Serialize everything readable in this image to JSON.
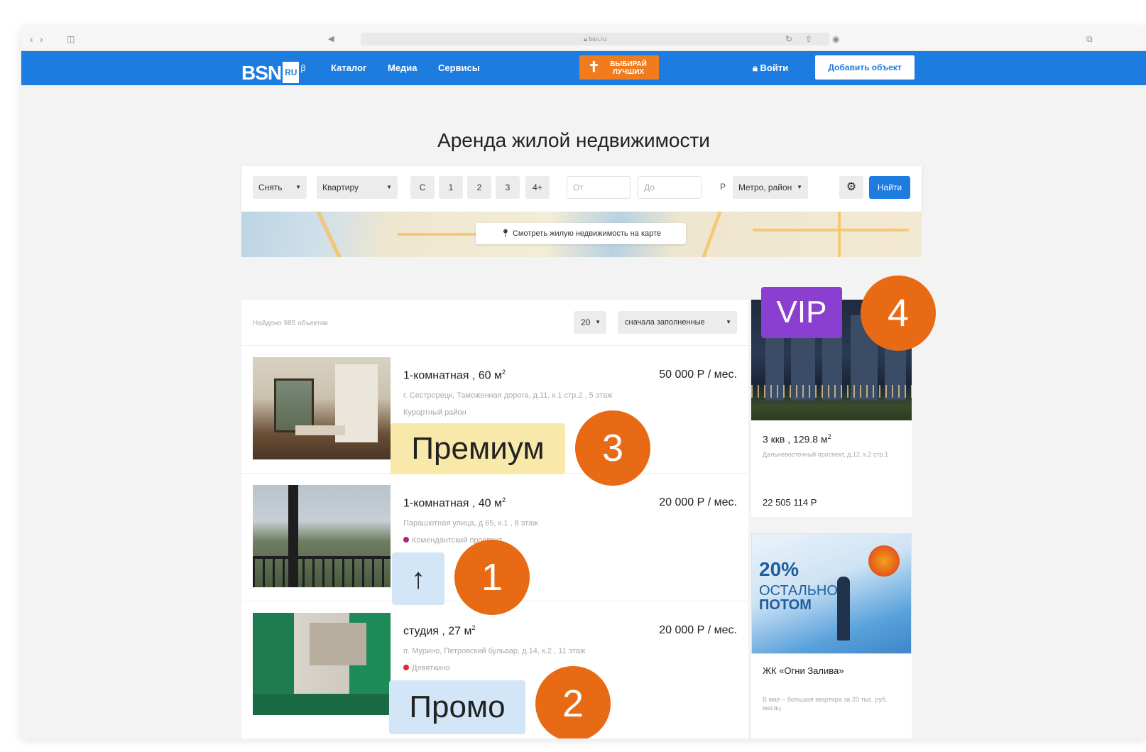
{
  "browser": {
    "url": "bsn.ru"
  },
  "nav": {
    "logo_text": "BSN",
    "logo_badge": "RU",
    "logo_beta": "β",
    "links": [
      "Каталог",
      "Медиа",
      "Сервисы"
    ],
    "promo_text": "ВЫБИРАЙ ЛУЧШИХ",
    "login": "Войти",
    "add_object": "Добавить объект",
    "brand_color": "#1d7ce0"
  },
  "page_title": "Аренда жилой недвижимости",
  "filters": {
    "deal_type": "Снять",
    "object_type": "Квартиру",
    "rooms": [
      "С",
      "1",
      "2",
      "3",
      "4+"
    ],
    "price_from_placeholder": "От",
    "price_to_placeholder": "До",
    "currency": "Р",
    "metro": "Метро, район",
    "search_label": "Найти"
  },
  "map": {
    "button_label": "Смотреть жилую недвижимость на карте"
  },
  "results": {
    "found_text": "Найдено 985 объектов",
    "per_page": "20",
    "sort": "сначала заполненные",
    "listings": [
      {
        "title": "1-комнатная , 60 м",
        "price": "50 000 Р / мес.",
        "address": "г. Сестрорецк, Таможенная дорога, д.11, к.1 стр.2 , 5 этаж",
        "district": "Курортный район",
        "metro_color": ""
      },
      {
        "title": "1-комнатная , 40 м",
        "price": "20 000 Р / мес.",
        "address": "Парашютная улица, д.65, к.1 , 8 этаж",
        "district": "Комендантский проспект",
        "metro_color": "#b0208a"
      },
      {
        "title": "студия , 27 м",
        "price": "20 000 Р / мес.",
        "address": "п. Мурино, Петровский бульвар, д.14, к.2 , 11 этаж",
        "district": "Девяткино",
        "metro_color": "#e3262a"
      }
    ]
  },
  "annotations": {
    "premium_label": "Премиум",
    "premium_number": "3",
    "up_arrow": "↑",
    "up_number": "1",
    "promo_label": "Промо",
    "promo_number": "2",
    "vip_label": "VIP",
    "vip_number": "4",
    "premium_color": "#f8e9aa",
    "promo_color": "#d3e6f7",
    "vip_color": "#8a3fd1",
    "circle_color": "#e86a15"
  },
  "sidebar": {
    "vip_ad": {
      "title": "3 ккв , 129.8 м",
      "address": "Дальневосточный проспект, д.12, к.2 стр.1",
      "price": "22 505 114 Р"
    },
    "ogni_ad": {
      "banner_pct": "20%",
      "banner_line1": "ОСТАЛЬНОЕ",
      "banner_line2": "ПОТОМ",
      "title": "ЖК «Огни Залива»",
      "description": "В мае – большая квартира за 20 тыс. руб. месяц"
    }
  }
}
